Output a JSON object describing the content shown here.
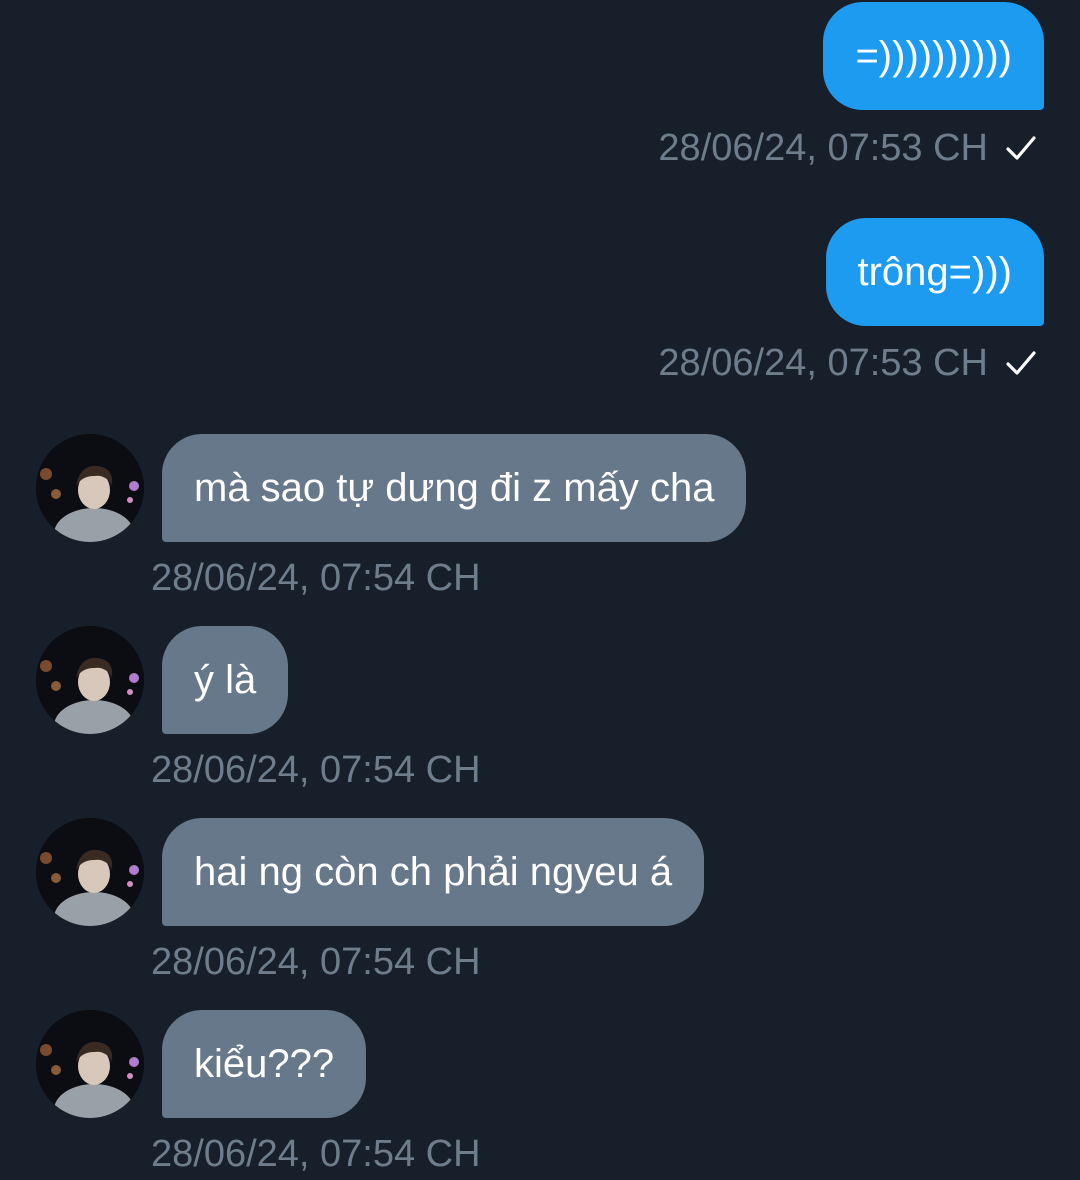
{
  "messages": [
    {
      "direction": "sent",
      "text": "=))))))))))",
      "time": "28/06/24, 07:53 CH",
      "status_icon": "check-icon"
    },
    {
      "direction": "sent",
      "text": "trông=)))",
      "time": "28/06/24, 07:53 CH",
      "status_icon": "check-icon"
    },
    {
      "direction": "received",
      "text": "mà sao tự dưng đi z mấy cha",
      "time": "28/06/24, 07:54 CH"
    },
    {
      "direction": "received",
      "text": "ý là",
      "time": "28/06/24, 07:54 CH"
    },
    {
      "direction": "received",
      "text": "hai ng còn ch phải ngyeu á",
      "time": "28/06/24, 07:54 CH"
    },
    {
      "direction": "received",
      "text": "kiểu???",
      "time": "28/06/24, 07:54 CH"
    }
  ],
  "colors": {
    "background": "#171f2a",
    "sent_bubble": "#1d9bf0",
    "received_bubble": "#66788a",
    "timestamp": "#6e7d8c"
  }
}
